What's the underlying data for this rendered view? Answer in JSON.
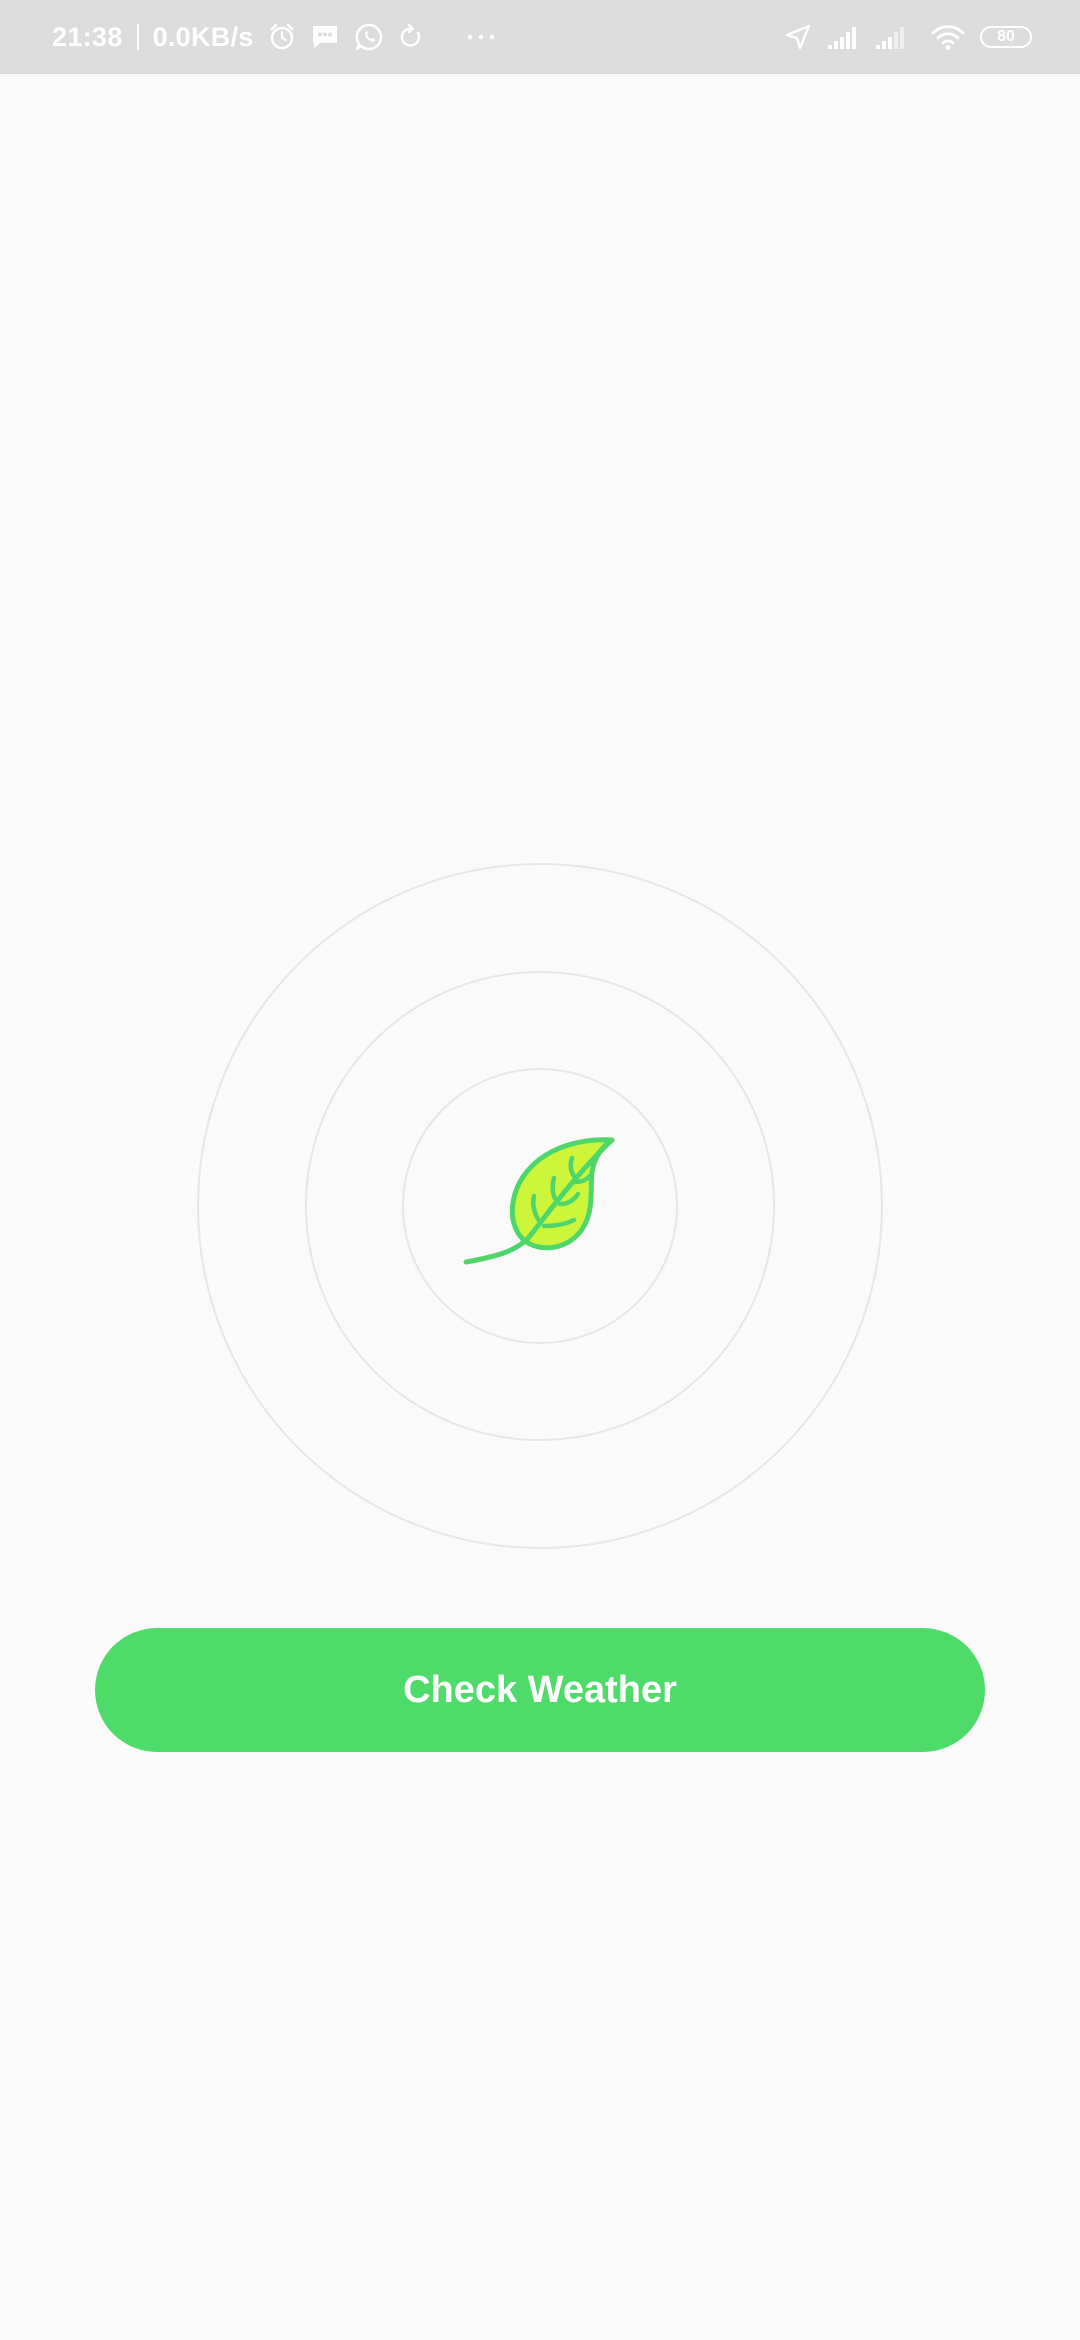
{
  "status_bar": {
    "time": "21:38",
    "speed": "0.0KB/s",
    "battery": "80",
    "icons_left": [
      "alarm-icon",
      "message-icon",
      "whatsapp-icon",
      "sync-icon",
      "more-dots-icon"
    ],
    "icons_right": [
      "location-icon",
      "signal-icon",
      "signal-icon-2",
      "wifi-icon",
      "battery-icon"
    ]
  },
  "main": {
    "logo_icon": "leaf-icon",
    "button_label": "Check Weather"
  },
  "colors": {
    "accent": "#4fdb69",
    "leaf_fill": "#cdf53a",
    "leaf_stroke": "#4fd66a",
    "ring": "#e6e6e6",
    "status_bg": "#dcdcdc",
    "background": "#fafafa"
  }
}
